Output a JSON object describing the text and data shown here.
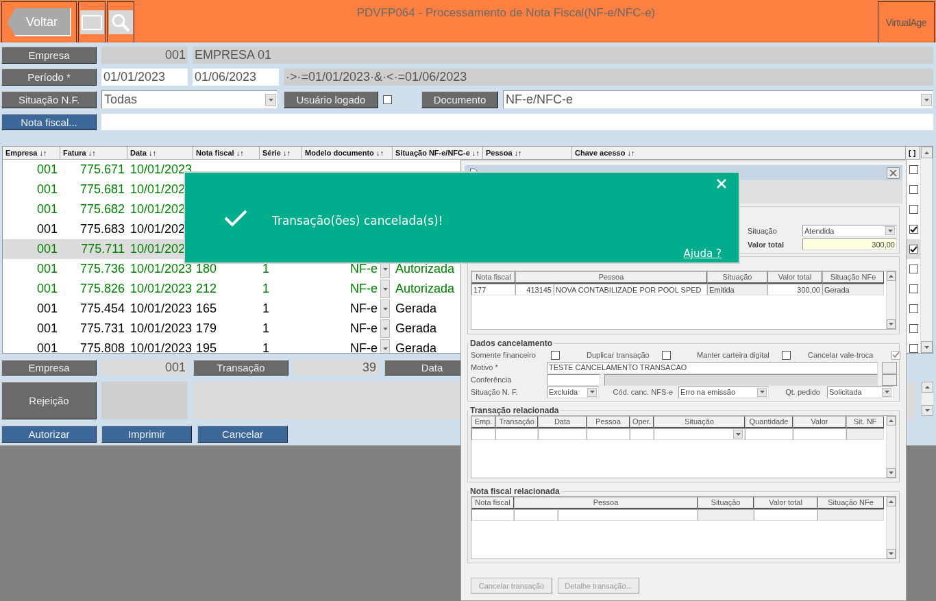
{
  "header": {
    "back_button": "Voltar",
    "title": "PDVFP064 - Processamento de Nota Fiscal(NF-e/NFC-e)",
    "brand": "VirtualAge"
  },
  "filters": {
    "empresa": {
      "label": "Empresa",
      "code": "001",
      "name": "EMPRESA 01"
    },
    "periodo": {
      "label": "Período *",
      "from": "01/01/2023",
      "to": "01/06/2023",
      "expression": "·>·=01/01/2023·&·<·=01/06/2023"
    },
    "situacao": {
      "label": "Situação N.F.",
      "value": "Todas"
    },
    "usuario_logado": {
      "label": "Usuário logado",
      "checked": false
    },
    "documento": {
      "label": "Documento",
      "value": "NF-e/NFC-e"
    },
    "nota_fiscal": {
      "label": "Nota fiscal..."
    }
  },
  "table": {
    "columns": [
      "Empresa ↓↑",
      "Fatura ↓↑",
      "Data ↓↑",
      "Nota fiscal ↓↑",
      "Série ↓↑",
      "Modelo documento ↓↑",
      "Situação NF-e/NFC-e ↓↑",
      "Pessoa ↓↑",
      "Chave acesso ↓↑",
      "[ ]"
    ],
    "rows": [
      {
        "cells": [
          "001",
          "775.671",
          "10/01/2023"
        ],
        "color": "#008000",
        "selected": false,
        "checked": false
      },
      {
        "cells": [
          "001",
          "775.681",
          "10/01/202"
        ],
        "color": "#008000",
        "selected": false,
        "checked": false
      },
      {
        "cells": [
          "001",
          "775.682",
          "10/01/202"
        ],
        "color": "#008000",
        "selected": false,
        "checked": false
      },
      {
        "cells": [
          "001",
          "775.683",
          "10/01/202"
        ],
        "color": "#000000",
        "selected": false,
        "checked": true
      },
      {
        "cells": [
          "001",
          "775.711",
          "10/01/202"
        ],
        "color": "#008000",
        "selected": true,
        "checked": true
      },
      {
        "cells": [
          "001",
          "775.736",
          "10/01/2023",
          "180",
          "1",
          "NF-e",
          "Autorizada"
        ],
        "color": "#008000",
        "selected": false,
        "checked": false
      },
      {
        "cells": [
          "001",
          "775.826",
          "10/01/2023",
          "212",
          "1",
          "NF-e",
          "Autorizada"
        ],
        "color": "#008000",
        "selected": false,
        "checked": false
      },
      {
        "cells": [
          "001",
          "775.454",
          "10/01/2023",
          "165",
          "1",
          "NF-e",
          "Gerada"
        ],
        "color": "#000000",
        "selected": false,
        "checked": false
      },
      {
        "cells": [
          "001",
          "775.731",
          "10/01/2023",
          "179",
          "1",
          "NF-e",
          "Gerada"
        ],
        "color": "#000000",
        "selected": false,
        "checked": false
      },
      {
        "cells": [
          "001",
          "775.808",
          "10/01/2023",
          "195",
          "1",
          "NF-e",
          "Gerada"
        ],
        "color": "#000000",
        "selected": false,
        "checked": false
      }
    ]
  },
  "footer": {
    "empresa_label": "Empresa",
    "empresa_value": "001",
    "transacao_label": "Transação",
    "transacao_value": "39",
    "data_label": "Data",
    "rejeicao_label": "Rejeição",
    "buttons": [
      "Autorizar",
      "Imprimir",
      "Cancelar"
    ]
  },
  "dialog": {
    "summary": {
      "situacao_label": "Situação",
      "situacao_value": "Atendida",
      "valor_total_label": "Valor total",
      "valor_total_value": "300,00"
    },
    "nota_grid": {
      "columns": [
        "Nota fiscal",
        "Pessoa",
        "Situação",
        "Valor total",
        "Situação NFe"
      ],
      "row": [
        "177",
        "413145",
        "NOVA CONTABILIZADE POR POOL SPED",
        "Emitida",
        "300,00",
        "Gerada"
      ]
    },
    "cancelamento": {
      "title": "Dados cancelamento",
      "options": [
        {
          "label": "Somente financeiro",
          "checked": false,
          "disabled": false
        },
        {
          "label": "Duplicar transação",
          "checked": false,
          "disabled": false
        },
        {
          "label": "Manter carteira digital",
          "checked": false,
          "disabled": false
        },
        {
          "label": "Cancelar vale-troca",
          "checked": true,
          "disabled": true
        }
      ],
      "motivo_label": "Motivo *",
      "motivo_value": "TESTE CANCELAMENTO TRANSACAO",
      "conferencia_label": "Conferência",
      "situacao_label": "Situação N. F.",
      "situacao_value": "Excluída",
      "cod_label": "Cód. canc. NFS-e",
      "cod_value": "Erro na emissão",
      "qt_label": "Qt. pedido",
      "qt_value": "Solicitada"
    },
    "transacao_relacionada": {
      "title": "Transação relacionada",
      "columns": [
        "Emp.",
        "Transação",
        "Data",
        "Pessoa",
        "Oper.",
        "Situação",
        "Quantidade",
        "Valor",
        "Sit. NF"
      ]
    },
    "nota_relacionada": {
      "title": "Nota fiscal relacionada",
      "columns": [
        "Nota fiscal",
        "Pessoa",
        "Situação",
        "Valor total",
        "Situação NFe"
      ]
    },
    "buttons": [
      {
        "label": "Cancelar transação",
        "disabled": true
      },
      {
        "label": "Detalhe transação...",
        "disabled": true
      }
    ]
  },
  "toast": {
    "message": "Transação(ões) cancelada(s)!",
    "help_link": "Ajuda ?"
  }
}
